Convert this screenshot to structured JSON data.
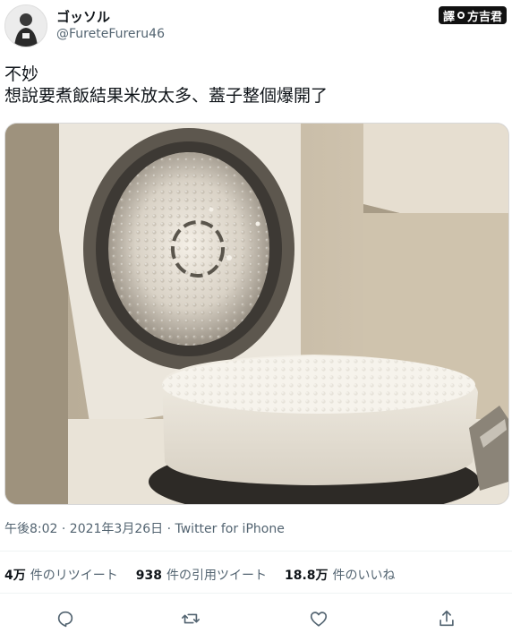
{
  "user": {
    "display_name": "ゴッソル",
    "handle": "@FureteFureru46"
  },
  "badge": {
    "text": "譯",
    "suffix": "方吉君"
  },
  "tweet": {
    "line1": "不妙",
    "line2": "想說要煮飯結果米放太多、蓋子整個爆開了"
  },
  "meta": "午後8:02 · 2021年3月26日 · Twitter for iPhone",
  "stats": {
    "retweets": {
      "value": "4万",
      "label": "件のリツイート"
    },
    "quotes": {
      "value": "938",
      "label": "件の引用ツイート"
    },
    "likes": {
      "value": "18.8万",
      "label": "件のいいね"
    }
  },
  "actions": [
    "reply-icon",
    "retweet-icon",
    "like-icon",
    "share-icon"
  ],
  "colors": {
    "muted": "#536471",
    "text": "#0f1419",
    "divider": "#eff3f4"
  }
}
